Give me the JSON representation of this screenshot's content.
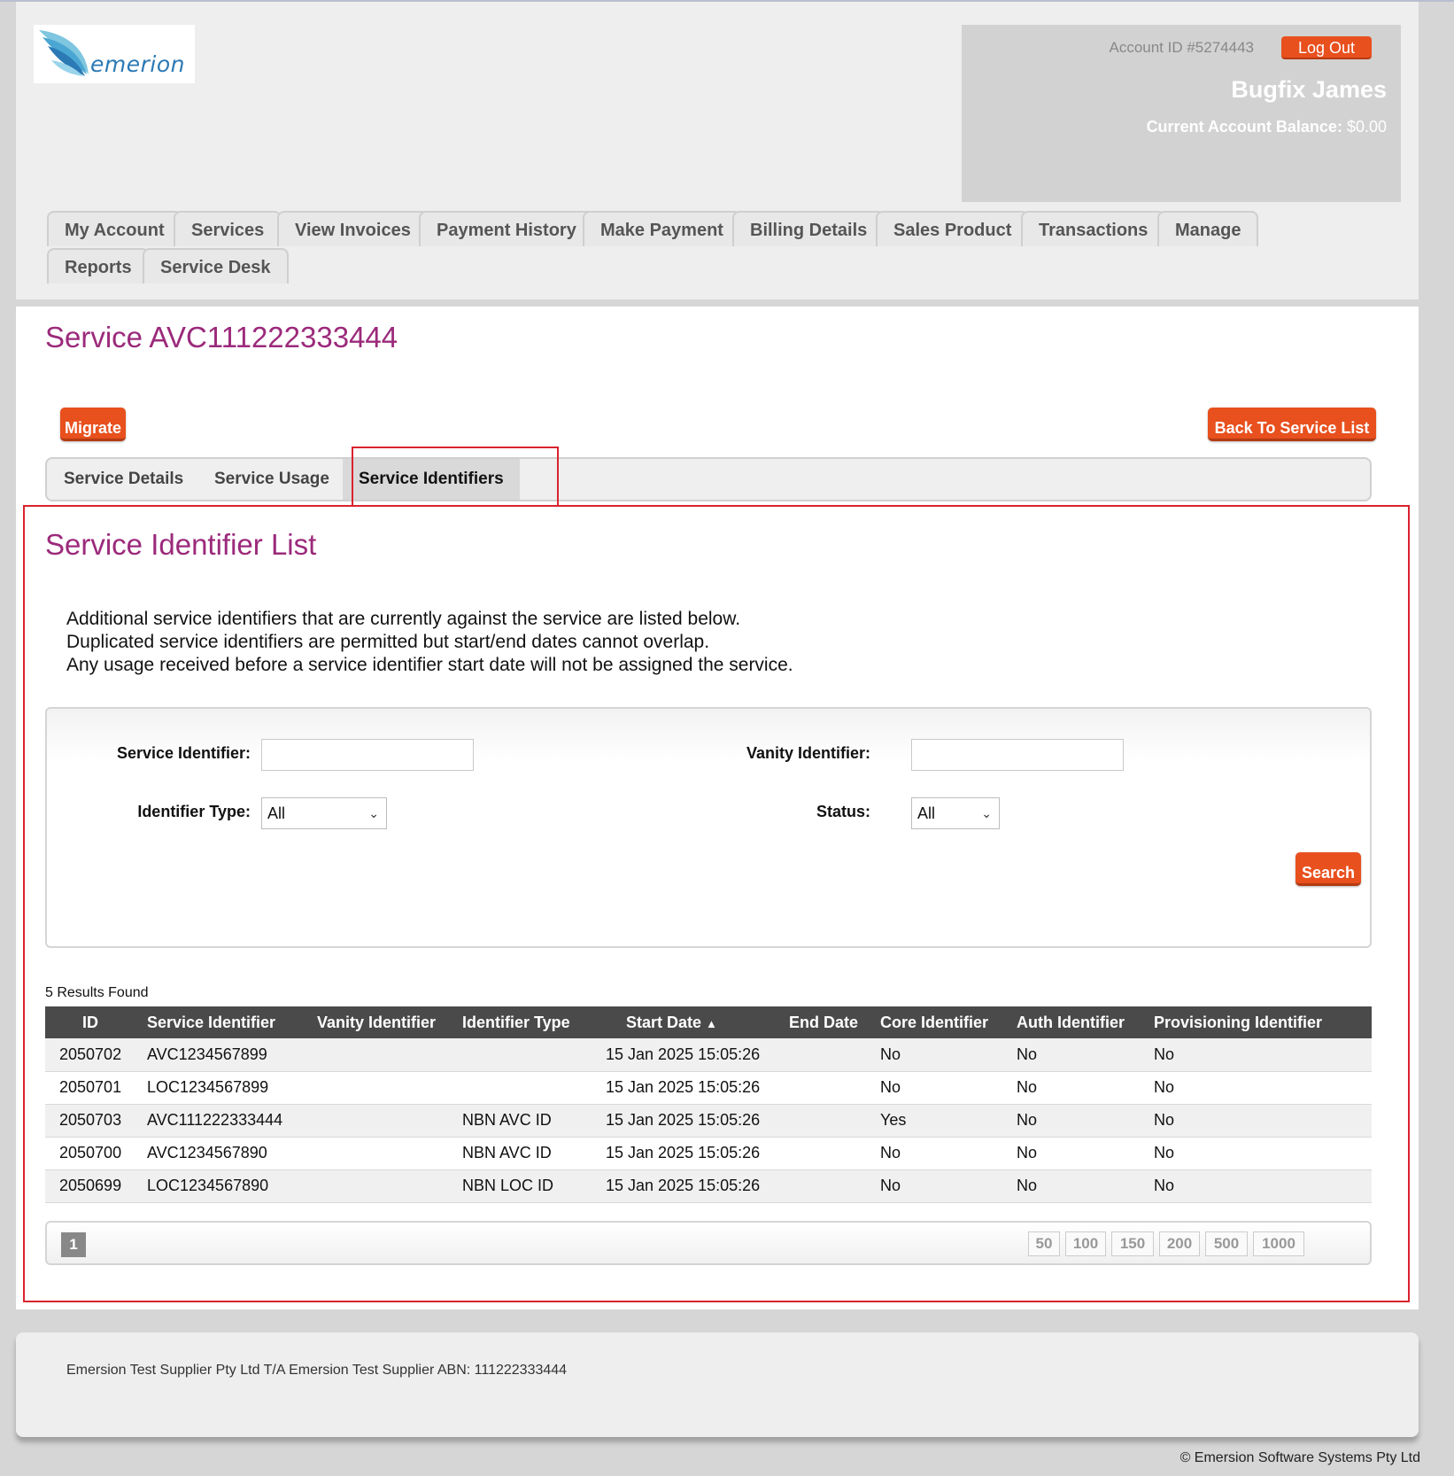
{
  "header": {
    "logo_text": "emerion",
    "account_id": "Account ID #5274443",
    "logout_label": "Log Out",
    "user_name": "Bugfix James",
    "balance_label": "Current Account Balance:",
    "balance_value": "$0.00"
  },
  "nav": {
    "tabs": [
      "My Account",
      "Services",
      "View Invoices",
      "Payment History",
      "Make Payment",
      "Billing Details",
      "Sales Product",
      "Transactions",
      "Manage",
      "Reports",
      "Service Desk"
    ]
  },
  "main": {
    "title": "Service AVC111222333444",
    "migrate_label": "Migrate",
    "back_label": "Back To Service List",
    "subtabs": [
      "Service Details",
      "Service Usage",
      "Service Identifiers"
    ],
    "active_subtab": "Service Identifiers",
    "section_title": "Service Identifier List",
    "description": [
      "Additional service identifiers that are currently against the service are listed below.",
      "Duplicated service identifiers are permitted but start/end dates cannot overlap.",
      "Any usage received before a service identifier start date will not be assigned the service."
    ]
  },
  "filters": {
    "service_identifier_label": "Service Identifier:",
    "service_identifier_value": "",
    "vanity_identifier_label": "Vanity Identifier:",
    "vanity_identifier_value": "",
    "identifier_type_label": "Identifier Type:",
    "identifier_type_value": "All",
    "status_label": "Status:",
    "status_value": "All",
    "search_label": "Search"
  },
  "results": {
    "count_text": "5 Results Found",
    "columns": [
      "ID",
      "Service Identifier",
      "Vanity Identifier",
      "Identifier Type",
      "Start Date",
      "End Date",
      "Core Identifier",
      "Auth Identifier",
      "Provisioning Identifier"
    ],
    "sort_indicator": "▲",
    "rows": [
      [
        "2050702",
        "AVC1234567899",
        "",
        "",
        "15 Jan 2025 15:05:26",
        "",
        "No",
        "No",
        "No"
      ],
      [
        "2050701",
        "LOC1234567899",
        "",
        "",
        "15 Jan 2025 15:05:26",
        "",
        "No",
        "No",
        "No"
      ],
      [
        "2050703",
        "AVC111222333444",
        "",
        "NBN AVC ID",
        "15 Jan 2025 15:05:26",
        "",
        "Yes",
        "No",
        "No"
      ],
      [
        "2050700",
        "AVC1234567890",
        "",
        "NBN AVC ID",
        "15 Jan 2025 15:05:26",
        "",
        "No",
        "No",
        "No"
      ],
      [
        "2050699",
        "LOC1234567890",
        "",
        "NBN LOC ID",
        "15 Jan 2025 15:05:26",
        "",
        "No",
        "No",
        "No"
      ]
    ]
  },
  "pager": {
    "current_page": "1",
    "page_sizes": [
      "50",
      "100",
      "150",
      "200",
      "500",
      "1000"
    ]
  },
  "footer": {
    "company_text": "Emersion Test Supplier Pty Ltd T/A Emersion Test Supplier ABN: 111222333444",
    "copyright": "© Emersion Software Systems Pty Ltd"
  },
  "colors": {
    "accent": "#e8501e",
    "title": "#9b2a7b",
    "highlight_outline": "#d9232e"
  }
}
